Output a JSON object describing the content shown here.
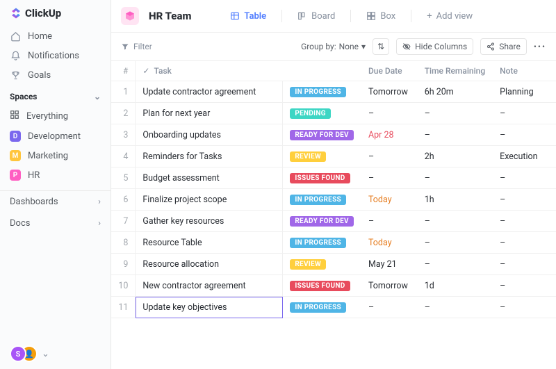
{
  "brand": "ClickUp",
  "nav": {
    "home": "Home",
    "notifications": "Notifications",
    "goals": "Goals"
  },
  "spaces_label": "Spaces",
  "spaces": {
    "everything": "Everything",
    "development": "Development",
    "marketing": "Marketing",
    "hr": "HR"
  },
  "space_initials": {
    "development": "D",
    "marketing": "M",
    "hr": "P"
  },
  "sidebar_sections": {
    "dashboards": "Dashboards",
    "docs": "Docs"
  },
  "header": {
    "title": "HR Team"
  },
  "views": {
    "table": "Table",
    "board": "Board",
    "box": "Box",
    "add": "Add view"
  },
  "toolbar": {
    "filter": "Filter",
    "groupby_label": "Group by:",
    "groupby_value": "None",
    "hide_columns": "Hide Columns",
    "share": "Share"
  },
  "columns": {
    "num": "#",
    "task": "Task",
    "status": "",
    "due": "Due Date",
    "time": "Time Remaining",
    "note": "Note"
  },
  "status_labels": {
    "inprogress": "IN PROGRESS",
    "pending": "PENDING",
    "readyfordev": "READY FOR DEV",
    "review": "REVIEW",
    "issuesfound": "ISSUES FOUND"
  },
  "rows": [
    {
      "n": "1",
      "task": "Update contractor agreement",
      "status": "inprogress",
      "due": "Tomorrow",
      "time": "6h 20m",
      "note": "Planning"
    },
    {
      "n": "2",
      "task": "Plan for next year",
      "status": "pending",
      "due": "–",
      "time": "–",
      "note": "–"
    },
    {
      "n": "3",
      "task": "Onboarding updates",
      "status": "readyfordev",
      "due": "Apr 28",
      "time": "–",
      "note": "–"
    },
    {
      "n": "4",
      "task": "Reminders for Tasks",
      "status": "review",
      "due": "–",
      "time": "2h",
      "note": "Execution"
    },
    {
      "n": "5",
      "task": "Budget assessment",
      "status": "issuesfound",
      "due": "–",
      "time": "–",
      "note": "–"
    },
    {
      "n": "6",
      "task": "Finalize project scope",
      "status": "inprogress",
      "due": "Today",
      "time": "1h",
      "note": "–"
    },
    {
      "n": "7",
      "task": "Gather key resources",
      "status": "readyfordev",
      "due": "–",
      "time": "–",
      "note": "–"
    },
    {
      "n": "8",
      "task": "Resource Table",
      "status": "inprogress",
      "due": "Today",
      "time": "–",
      "note": "–"
    },
    {
      "n": "9",
      "task": "Resource allocation",
      "status": "review",
      "due": "May 21",
      "time": "–",
      "note": "–"
    },
    {
      "n": "10",
      "task": "New contractor agreement",
      "status": "issuesfound",
      "due": "Tomorrow",
      "time": "1d",
      "note": "–"
    },
    {
      "n": "11",
      "task": "Update key objectives",
      "status": "inprogress",
      "due": "–",
      "time": "–",
      "note": "–"
    }
  ],
  "avatars": {
    "a1": "S"
  }
}
